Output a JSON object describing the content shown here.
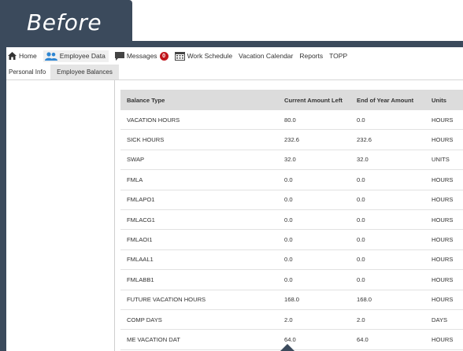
{
  "banner": {
    "label": "Before"
  },
  "nav": {
    "home": "Home",
    "employee_data": "Employee Data",
    "messages": "Messages",
    "messages_count": "0",
    "work_schedule": "Work Schedule",
    "vacation_calendar": "Vacation Calendar",
    "reports": "Reports",
    "topp": "TOPP"
  },
  "subnav": {
    "personal_info": "Personal Info",
    "employee_balances": "Employee Balances"
  },
  "table": {
    "headers": [
      "Balance Type",
      "Current Amount Left",
      "End of Year Amount",
      "Units"
    ],
    "rows": [
      [
        "VACATION HOURS",
        "80.0",
        "0.0",
        "HOURS"
      ],
      [
        "SICK HOURS",
        "232.6",
        "232.6",
        "HOURS"
      ],
      [
        "SWAP",
        "32.0",
        "32.0",
        "UNITS"
      ],
      [
        "FMLA",
        "0.0",
        "0.0",
        "HOURS"
      ],
      [
        "FMLAPO1",
        "0.0",
        "0.0",
        "HOURS"
      ],
      [
        "FMLACG1",
        "0.0",
        "0.0",
        "HOURS"
      ],
      [
        "FMLAOI1",
        "0.0",
        "0.0",
        "HOURS"
      ],
      [
        "FMLAAL1",
        "0.0",
        "0.0",
        "HOURS"
      ],
      [
        "FMLABB1",
        "0.0",
        "0.0",
        "HOURS"
      ],
      [
        "FUTURE VACATION HOURS",
        "168.0",
        "168.0",
        "HOURS"
      ],
      [
        "COMP DAYS",
        "2.0",
        "2.0",
        "DAYS"
      ],
      [
        "ME VACATION DAT",
        "64.0",
        "64.0",
        "HOURS"
      ]
    ]
  },
  "icons": {
    "home": "home-icon",
    "employee": "people-icon",
    "messages": "chat-icon",
    "schedule": "calendar-icon"
  },
  "colors": {
    "frame": "#3b4a5c",
    "badge": "#c0161c",
    "people_icon": "#2f86d2",
    "header_bg": "#dcdcdc"
  }
}
